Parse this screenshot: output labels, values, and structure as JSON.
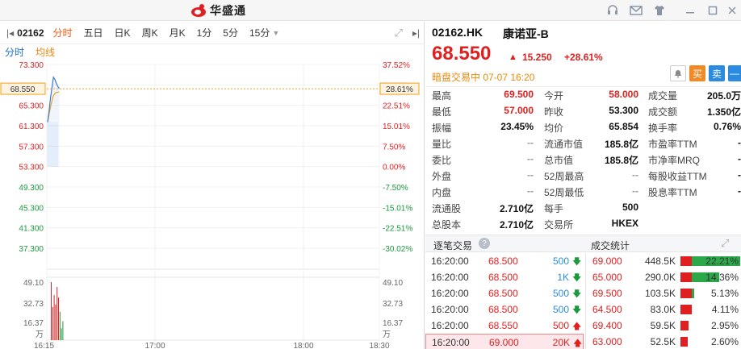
{
  "app": {
    "brand": "华盛通"
  },
  "toolbar": {
    "code": "02162",
    "tabs": [
      "分时",
      "五日",
      "日K",
      "周K",
      "月K",
      "1分",
      "5分",
      "15分"
    ],
    "active_tab": "分时",
    "subtabs": [
      "分时",
      "均线"
    ]
  },
  "chart_data": {
    "type": "line",
    "price_axis": [
      "73.300",
      "69.300",
      "65.300",
      "61.300",
      "57.300",
      "53.300",
      "49.300",
      "45.300",
      "41.300",
      "37.300"
    ],
    "pct_axis": [
      "37.52%",
      "30.02%",
      "22.51%",
      "15.01%",
      "7.50%",
      "0.00%",
      "-7.50%",
      "-15.01%",
      "-22.51%",
      "-30.02%"
    ],
    "current_price_label": "68.550",
    "current_pct_label": "28.61%",
    "volume_axis": [
      "49.10",
      "32.73",
      "16.37",
      "万"
    ],
    "time_axis": [
      "16:15",
      "17:00",
      "18:00",
      "18:30"
    ],
    "ylim": [
      37.3,
      73.3
    ],
    "prev_close": 53.3,
    "price_series": [
      {
        "t": 0,
        "v": 62.0
      },
      {
        "t": 1,
        "v": 64.2
      },
      {
        "t": 2,
        "v": 66.8
      },
      {
        "t": 3,
        "v": 68.8
      },
      {
        "t": 4,
        "v": 70.8
      },
      {
        "t": 5,
        "v": 70.4
      },
      {
        "t": 6,
        "v": 69.6
      },
      {
        "t": 7,
        "v": 69.0
      },
      {
        "t": 8,
        "v": 68.55
      }
    ],
    "avg_series": [
      {
        "t": 0,
        "v": 62.0
      },
      {
        "t": 1,
        "v": 63.5
      },
      {
        "t": 2,
        "v": 65.0
      },
      {
        "t": 3,
        "v": 66.2
      },
      {
        "t": 4,
        "v": 67.2
      },
      {
        "t": 5,
        "v": 67.6
      },
      {
        "t": 6,
        "v": 67.8
      },
      {
        "t": 7,
        "v": 67.9
      },
      {
        "t": 8,
        "v": 67.9
      }
    ],
    "volume_series": [
      {
        "t": 0,
        "v": 49.1,
        "c": "red"
      },
      {
        "t": 1,
        "v": 28.0,
        "c": "red"
      },
      {
        "t": 2,
        "v": 38.0,
        "c": "red"
      },
      {
        "t": 3,
        "v": 30.0,
        "c": "red"
      },
      {
        "t": 4,
        "v": 45.0,
        "c": "red"
      },
      {
        "t": 5,
        "v": 36.0,
        "c": "red"
      },
      {
        "t": 6,
        "v": 24.0,
        "c": "green"
      },
      {
        "t": 7,
        "v": 10.0,
        "c": "green"
      },
      {
        "t": 8,
        "v": 16.0,
        "c": "green"
      }
    ],
    "volume_max": 49.1,
    "colors": {
      "price": "#3a7bd5",
      "avg": "#f0a020",
      "up": "#e02020",
      "down": "#1a9a3e"
    }
  },
  "quote": {
    "code": "02162.HK",
    "name": "康诺亚-B",
    "price": "68.550",
    "change": "15.250",
    "change_pct": "+28.61%",
    "status": "暗盘交易中 07-07 16:20",
    "buy_label": "买",
    "sell_label": "卖",
    "fields": [
      {
        "l": "最高",
        "v": "69.500",
        "c": "red",
        "l2": "今开",
        "v2": "58.000",
        "c2": "red",
        "l3": "成交量",
        "v3": "205.0万"
      },
      {
        "l": "最低",
        "v": "57.000",
        "c": "red",
        "l2": "昨收",
        "v2": "53.300",
        "c2": "",
        "l3": "成交额",
        "v3": "1.350亿"
      },
      {
        "l": "振幅",
        "v": "23.45%",
        "c": "",
        "l2": "均价",
        "v2": "65.854",
        "c2": "",
        "l3": "换手率",
        "v3": "0.76%"
      },
      {
        "l": "量比",
        "v": "--",
        "c": "gray",
        "l2": "流通市值",
        "v2": "185.8亿",
        "c2": "",
        "l3": "市盈率TTM",
        "v3": "-"
      },
      {
        "l": "委比",
        "v": "--",
        "c": "gray",
        "l2": "总市值",
        "v2": "185.8亿",
        "c2": "",
        "l3": "市净率MRQ",
        "v3": "-"
      },
      {
        "l": "外盘",
        "v": "--",
        "c": "gray",
        "l2": "52周最高",
        "v2": "--",
        "c2": "gray",
        "l3": "每股收益TTM",
        "v3": "-"
      },
      {
        "l": "内盘",
        "v": "--",
        "c": "gray",
        "l2": "52周最低",
        "v2": "--",
        "c2": "gray",
        "l3": "股息率TTM",
        "v3": "-"
      },
      {
        "l": "流通股",
        "v": "2.710亿",
        "c": "",
        "l2": "每手",
        "v2": "500",
        "c2": "",
        "l3": "",
        "v3": ""
      },
      {
        "l": "总股本",
        "v": "2.710亿",
        "c": "",
        "l2": "交易所",
        "v2": "HKEX",
        "c2": "",
        "l3": "",
        "v3": ""
      }
    ]
  },
  "trades": {
    "title": "逐笔交易",
    "rows": [
      {
        "time": "16:20:00",
        "price": "68.500",
        "vol": "500",
        "dir": "down"
      },
      {
        "time": "16:20:00",
        "price": "68.500",
        "vol": "1K",
        "dir": "down"
      },
      {
        "time": "16:20:00",
        "price": "68.500",
        "vol": "500",
        "dir": "down"
      },
      {
        "time": "16:20:00",
        "price": "68.500",
        "vol": "500",
        "dir": "down"
      },
      {
        "time": "16:20:00",
        "price": "68.550",
        "vol": "500",
        "dir": "up"
      },
      {
        "time": "16:20:00",
        "price": "69.000",
        "vol": "20K",
        "dir": "up"
      }
    ]
  },
  "stats": {
    "title": "成交统计",
    "rows": [
      {
        "price": "69.000",
        "vol": "448.5K",
        "pct": "22.21%",
        "p": 22.21
      },
      {
        "price": "65.000",
        "vol": "290.0K",
        "pct": "14.36%",
        "p": 14.36
      },
      {
        "price": "69.500",
        "vol": "103.5K",
        "pct": "5.13%",
        "p": 5.13
      },
      {
        "price": "64.500",
        "vol": "83.0K",
        "pct": "4.11%",
        "p": 4.11
      },
      {
        "price": "69.400",
        "vol": "59.5K",
        "pct": "2.95%",
        "p": 2.95
      },
      {
        "price": "63.000",
        "vol": "52.5K",
        "pct": "2.60%",
        "p": 2.6
      }
    ]
  }
}
